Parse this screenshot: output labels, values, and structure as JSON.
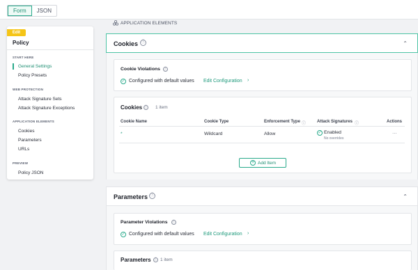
{
  "toggle": {
    "form": "Form",
    "json": "JSON"
  },
  "sidebar": {
    "badge": "Edit",
    "title": "Policy",
    "sections": {
      "start_here": "START HERE",
      "web_protection": "WEB PROTECTION",
      "application_elements": "APPLICATION ELEMENTS",
      "preview": "PREVIEW"
    },
    "items": {
      "general_settings": "General Settings",
      "policy_presets": "Policy Presets",
      "attack_signature_sets": "Attack Signature Sets",
      "attack_signature_exceptions": "Attack Signature Exceptions",
      "cookies": "Cookies",
      "parameters": "Parameters",
      "urls": "URLs",
      "policy_json": "Policy JSON"
    }
  },
  "main": {
    "section_label": "APPLICATION ELEMENTS",
    "cookies": {
      "title": "Cookies",
      "violations": {
        "title": "Cookie Violations",
        "status": "Configured with default values",
        "edit_link": "Edit Configuration"
      },
      "table": {
        "title": "Cookies",
        "count": "1 item",
        "headers": {
          "name": "Cookie Name",
          "type": "Cookie Type",
          "enforcement": "Enforcement Type",
          "signatures": "Attack Signatures",
          "actions": "Actions"
        },
        "rows": [
          {
            "name": "*",
            "type": "Wildcard",
            "enforcement": "Allow",
            "signatures": "Enabled",
            "overrides": "No overrides",
            "actions": "···"
          }
        ],
        "add_label": "Add Item"
      }
    },
    "parameters": {
      "title": "Parameters",
      "violations": {
        "title": "Parameter Violations",
        "status": "Configured with default values",
        "edit_link": "Edit Configuration"
      },
      "table": {
        "title": "Parameters",
        "count": "1 item"
      }
    }
  },
  "icons": {
    "info": "ⓘ",
    "chevron_up": "⌃",
    "check": "✓",
    "plus": "+",
    "arrow": "›"
  },
  "colors": {
    "accent": "#27a98a",
    "badge": "#f5c518"
  }
}
